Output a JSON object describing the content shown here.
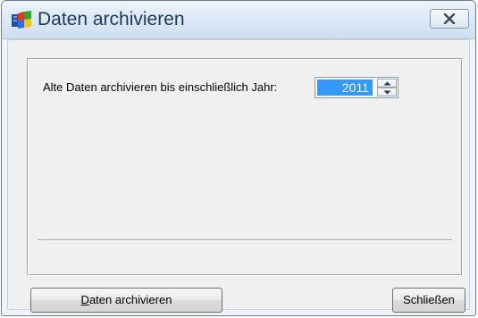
{
  "window": {
    "title": "Daten archivieren",
    "icon": "app-icon",
    "close_icon": "close-icon"
  },
  "form": {
    "label": "Alte Daten archivieren bis einschließlich Jahr:",
    "year_value": "2011"
  },
  "buttons": {
    "archive": {
      "mnemonic": "D",
      "rest": "aten archivieren"
    },
    "close": {
      "label": "Schließen"
    }
  },
  "colors": {
    "selection": "#3399ff",
    "titlebar_text": "#1e3a5a"
  }
}
